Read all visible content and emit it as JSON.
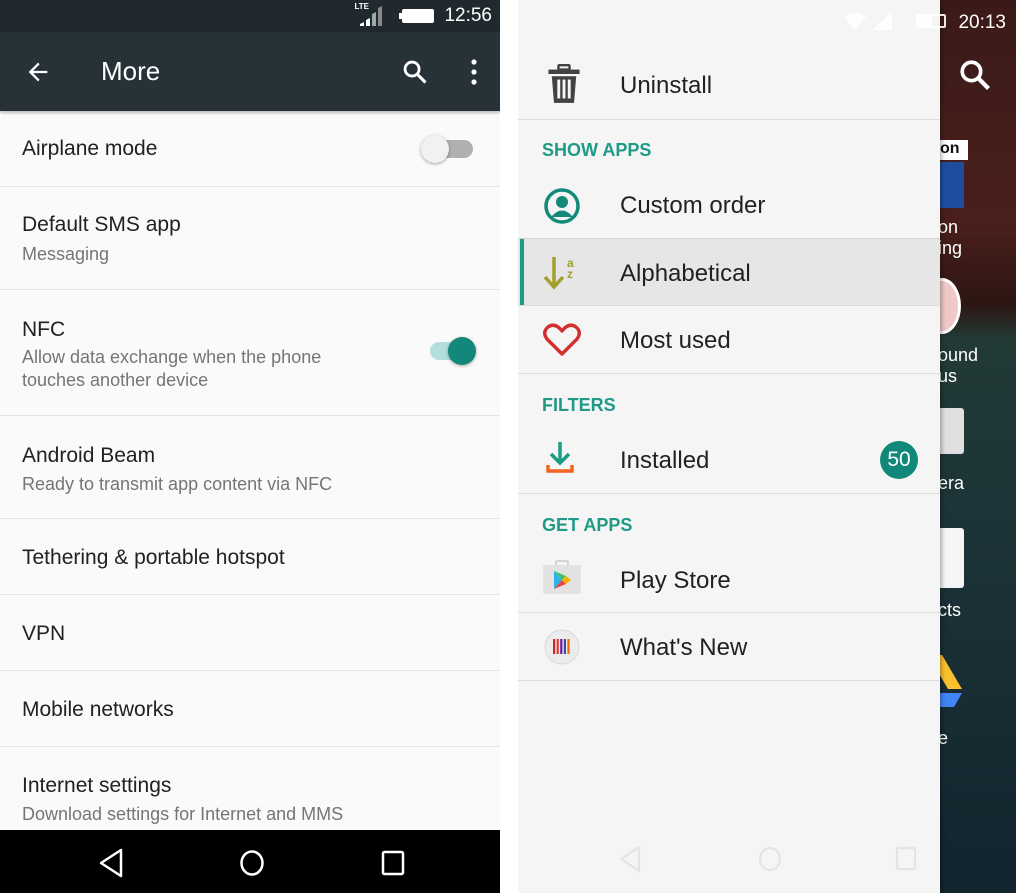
{
  "left_screen": {
    "status_bar": {
      "network": "LTE",
      "time": "12:56"
    },
    "app_bar": {
      "title": "More",
      "back_icon": "arrow-left-icon",
      "search_icon": "search-icon",
      "overflow_icon": "more-vert-icon"
    },
    "settings": [
      {
        "title": "Airplane mode",
        "subtitle": "",
        "toggle": "off"
      },
      {
        "title": "Default SMS app",
        "subtitle": "Messaging"
      },
      {
        "title": "NFC",
        "subtitle_line1": "Allow data exchange when the phone",
        "subtitle_line2": "touches another device",
        "toggle": "on"
      },
      {
        "title": "Android Beam",
        "subtitle": "Ready to transmit app content via NFC"
      },
      {
        "title": "Tethering & portable hotspot"
      },
      {
        "title": "VPN"
      },
      {
        "title": "Mobile networks"
      },
      {
        "title": "Internet settings",
        "subtitle": "Download settings for Internet and MMS"
      }
    ],
    "nav_bar": [
      "back",
      "home",
      "recents"
    ]
  },
  "right_screen": {
    "status_bar": {
      "time": "20:13"
    },
    "drawer": {
      "top_item": {
        "label": "Uninstall",
        "icon": "trash-icon"
      },
      "sections": [
        {
          "header": "SHOW APPS",
          "items": [
            {
              "label": "Custom order",
              "icon": "person-circle-icon"
            },
            {
              "label": "Alphabetical",
              "icon": "sort-az-icon",
              "selected": true
            },
            {
              "label": "Most used",
              "icon": "heart-icon"
            }
          ]
        },
        {
          "header": "FILTERS",
          "items": [
            {
              "label": "Installed",
              "icon": "download-icon",
              "badge": "50"
            }
          ]
        },
        {
          "header": "GET APPS",
          "items": [
            {
              "label": "Play Store",
              "icon": "play-store-icon"
            },
            {
              "label": "What's New",
              "icon": "whats-new-icon"
            }
          ]
        }
      ]
    },
    "background_labels": [
      "on",
      "on",
      "ing",
      "ound",
      "us",
      "era",
      "cts",
      "e"
    ]
  },
  "colors": {
    "accent": "#1e9a86",
    "toggle_on_thumb": "#12887a",
    "toggle_on_track": "#b2dfdb",
    "app_bar": "#263238",
    "status_bar": "#20292e"
  }
}
